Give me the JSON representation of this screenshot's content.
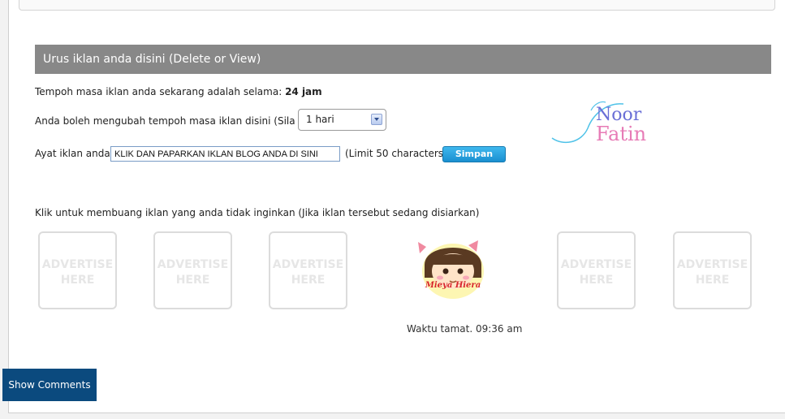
{
  "header": {
    "title": "Urus iklan anda disini (Delete or View)"
  },
  "duration": {
    "prefix": "Tempoh masa iklan anda sekarang adalah selama:",
    "value": "24 jam"
  },
  "change_duration": {
    "label": "Anda boleh mengubah tempoh masa iklan disini (Sila pilih):",
    "selected": "1 hari"
  },
  "ad_text": {
    "label": "Ayat iklan anda:",
    "value": "KLIK DAN PAPARKAN IKLAN BLOG ANDA DI SINI",
    "limit": "(Limit 50 characters)",
    "save_label": "Simpan"
  },
  "logo": {
    "line1": "Noor",
    "line2": "Fatin"
  },
  "remove_instruction": "Klik untuk membuang iklan yang anda tidak inginkan (Jika iklan tersebut sedang disiarkan)",
  "ad_placeholder": {
    "line1": "ADVERTISE",
    "line2": "HERE"
  },
  "active_ad": {
    "caption": "Mieya Hiera",
    "expiry": "Waktu tamat. 09:36 am"
  },
  "comments_button": "Show Comments",
  "colors": {
    "header_bg": "#888888",
    "save_button": "#2aa3e0",
    "comments_button": "#0b4a7e"
  }
}
